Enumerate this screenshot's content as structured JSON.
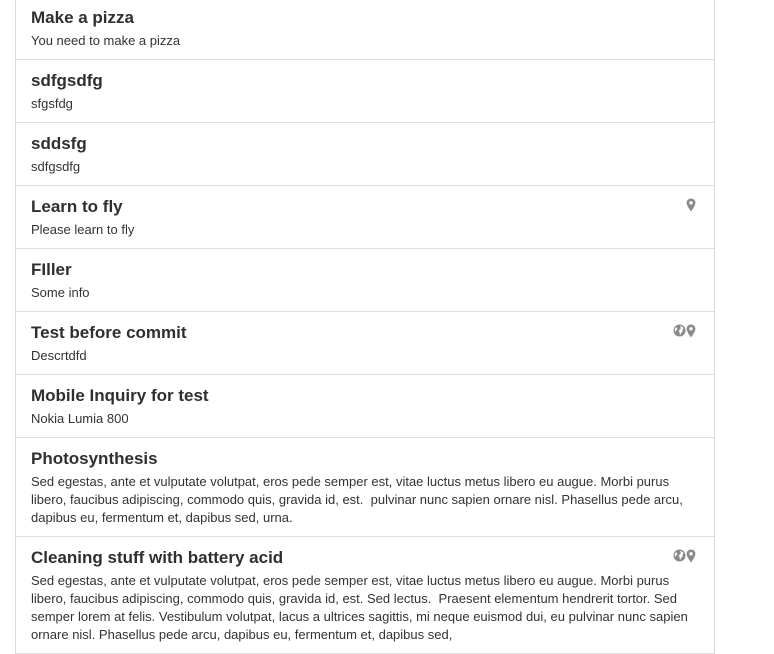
{
  "items": [
    {
      "title": "Make a pizza",
      "description": "You need to make a pizza",
      "icons": []
    },
    {
      "title": "sdfgsdfg",
      "description": "sfgsfdg",
      "icons": []
    },
    {
      "title": "sddsfg",
      "description": "sdfgsdfg",
      "icons": []
    },
    {
      "title": "Learn to fly",
      "description": "Please learn to fly",
      "icons": [
        "map-marker-icon"
      ]
    },
    {
      "title": "FIller",
      "description": "Some info",
      "icons": []
    },
    {
      "title": "Test before commit",
      "description": "Descrtdfd",
      "icons": [
        "globe-icon",
        "map-marker-icon"
      ]
    },
    {
      "title": "Mobile Inquiry for test",
      "description": "Nokia Lumia 800",
      "icons": []
    },
    {
      "title": "Photosynthesis",
      "description": "Sed egestas, ante et vulputate volutpat, eros pede semper est, vitae luctus metus libero eu augue. Morbi purus libero, faucibus adipiscing, commodo quis, gravida id, est.  pulvinar nunc sapien ornare nisl. Phasellus pede arcu, dapibus eu, fermentum et, dapibus sed, urna.",
      "icons": []
    },
    {
      "title": "Cleaning stuff with battery acid",
      "description": "Sed egestas, ante et vulputate volutpat, eros pede semper est, vitae luctus metus libero eu augue. Morbi purus libero, faucibus adipiscing, commodo quis, gravida id, est. Sed lectus.  Praesent elementum hendrerit tortor. Sed semper lorem at felis. Vestibulum volutpat, lacus a ultrices sagittis, mi neque euismod dui, eu pulvinar nunc sapien ornare nisl. Phasellus pede arcu, dapibus eu, fermentum et, dapibus sed,",
      "icons": [
        "globe-icon",
        "map-marker-icon"
      ]
    }
  ],
  "colors": {
    "border": "#dddddd",
    "title": "#2f2f2f",
    "text": "#333333",
    "icon": "#8a8a8a"
  }
}
